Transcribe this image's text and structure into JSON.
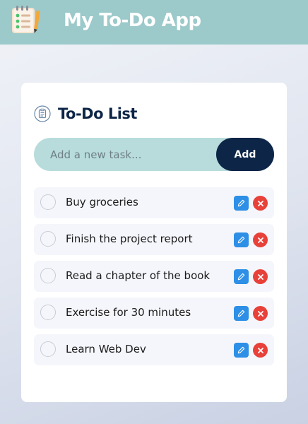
{
  "header": {
    "title": "My To-Do App",
    "logo_icon": "notepad-checklist-icon",
    "background": "#9cc9c9"
  },
  "card": {
    "title": "To-Do List",
    "title_icon": "clipboard-list-icon",
    "input_placeholder": "Add a new task...",
    "input_value": "",
    "add_label": "Add"
  },
  "tasks": [
    {
      "text": "Buy groceries",
      "done": false
    },
    {
      "text": "Finish the project report",
      "done": false
    },
    {
      "text": "Read a chapter of the book",
      "done": false
    },
    {
      "text": "Exercise for 30 minutes",
      "done": false
    },
    {
      "text": "Learn Web Dev",
      "done": false
    }
  ],
  "colors": {
    "primary_dark": "#0d2547",
    "input_bg": "#b7dcdb",
    "edit_blue": "#2d8fe6",
    "delete_red": "#e8413a"
  },
  "icons": {
    "edit": "pencil-icon",
    "delete": "close-icon",
    "check": "circle-checkbox-icon"
  }
}
